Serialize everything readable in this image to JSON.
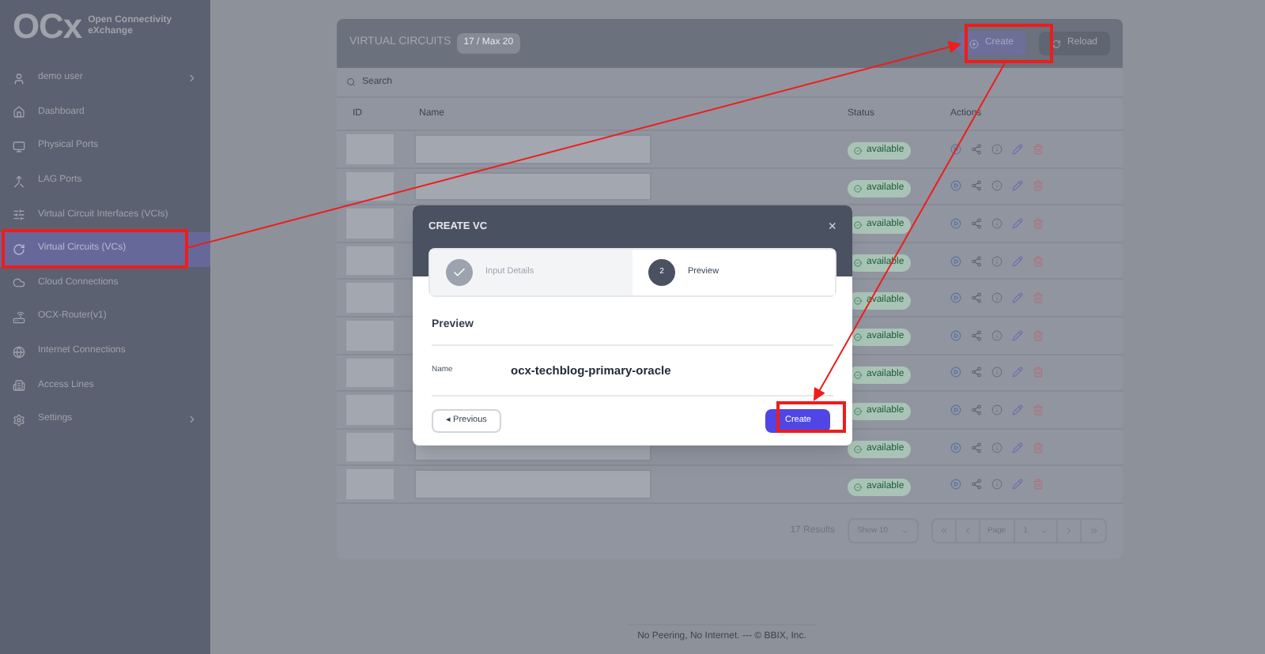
{
  "brand": {
    "logo": "OCx",
    "name_line1": "Open Connectivity",
    "name_line2": "eXchange"
  },
  "sidebar": {
    "items": [
      {
        "label": "demo user",
        "has_submenu": true,
        "selected": false
      },
      {
        "label": "Dashboard",
        "has_submenu": false,
        "selected": false
      },
      {
        "label": "Physical Ports",
        "has_submenu": false,
        "selected": false
      },
      {
        "label": "LAG Ports",
        "has_submenu": false,
        "selected": false
      },
      {
        "label": "Virtual Circuit Interfaces (VCIs)",
        "has_submenu": false,
        "selected": false
      },
      {
        "label": "Virtual Circuits (VCs)",
        "has_submenu": false,
        "selected": true
      },
      {
        "label": "Cloud Connections",
        "has_submenu": false,
        "selected": false
      },
      {
        "label": "OCX-Router(v1)",
        "has_submenu": false,
        "selected": false
      },
      {
        "label": "Internet Connections",
        "has_submenu": false,
        "selected": false
      },
      {
        "label": "Access Lines",
        "has_submenu": false,
        "selected": false
      },
      {
        "label": "Settings",
        "has_submenu": true,
        "selected": false
      }
    ]
  },
  "panel": {
    "title": "VIRTUAL CIRCUITS",
    "count_badge": "17 / Max 20",
    "buttons": [
      {
        "label": "Create",
        "kind": "primary"
      },
      {
        "label": "Reload",
        "kind": "secondary"
      }
    ],
    "search": {
      "placeholder": "Search"
    },
    "table": {
      "columns": [
        "ID",
        "Name",
        "Status",
        "Actions"
      ],
      "rows": [
        {
          "status": "available"
        },
        {
          "status": "available"
        },
        {
          "status": "available"
        },
        {
          "status": "available"
        },
        {
          "status": "available"
        },
        {
          "status": "available"
        },
        {
          "status": "available"
        },
        {
          "status": "available"
        },
        {
          "status": "available"
        },
        {
          "status": "available"
        }
      ]
    },
    "pagination": {
      "results": "17 Results",
      "page_size": "Show 10",
      "page_label": "Page",
      "page": "1"
    }
  },
  "footer": "No Peering, No Internet. --- © BBIX, Inc.",
  "modal": {
    "title": "CREATE VC",
    "close": "×",
    "steps": [
      {
        "label": "Input Details",
        "done": true,
        "selected": false
      },
      {
        "number": "2",
        "label": "Preview",
        "done": false,
        "selected": true
      }
    ],
    "section_title": "Preview",
    "fields": [
      {
        "label": "Name",
        "value": "ocx-techblog-primary-oracle"
      }
    ],
    "previous_button": "◂ Previous",
    "create_button": "Create"
  }
}
